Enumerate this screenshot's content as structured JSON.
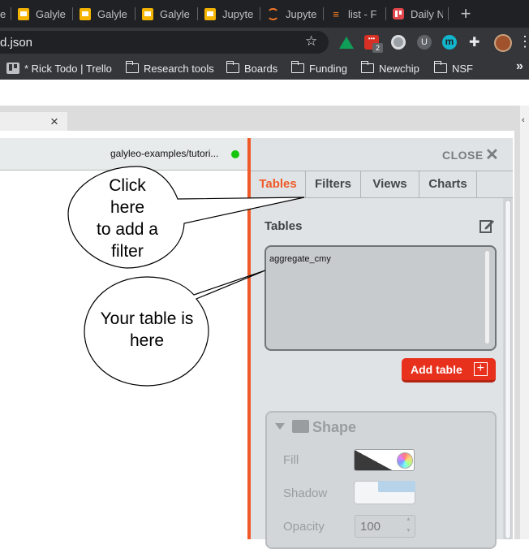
{
  "browser": {
    "tabs": [
      {
        "label": "e",
        "icon": "slides-icon"
      },
      {
        "label": "Galyle",
        "icon": "slides-icon"
      },
      {
        "label": "Galyle",
        "icon": "slides-icon"
      },
      {
        "label": "Galyle",
        "icon": "slides-icon"
      },
      {
        "label": "Jupyte",
        "icon": "slides-icon"
      },
      {
        "label": "Jupyte",
        "icon": "jupyter-icon"
      },
      {
        "label": "list - F",
        "icon": "stackoverflow-icon"
      },
      {
        "label": "Daily N",
        "icon": "trello-icon"
      }
    ],
    "new_tab_glyph": "+",
    "url": "d.json",
    "bookmark_star": "☆",
    "extension_badge": "2",
    "extension_m": "m",
    "bookmarks": [
      {
        "label": "* Rick Todo | Trello",
        "icon": "trello-icon"
      },
      {
        "label": "Research tools",
        "icon": "folder-icon"
      },
      {
        "label": "Boards",
        "icon": "folder-icon"
      },
      {
        "label": "Funding",
        "icon": "folder-icon"
      },
      {
        "label": "Newchip",
        "icon": "folder-icon"
      },
      {
        "label": "NSF",
        "icon": "folder-icon"
      }
    ],
    "bookmarks_overflow": "»"
  },
  "app": {
    "tab_close": "×",
    "file_path": "galyleo-examples/tutori...",
    "status_color": "#16c60c",
    "panel": {
      "close_label": "CLOSE",
      "close_icon": "✕",
      "tabs": [
        "Tables",
        "Filters",
        "Views",
        "Charts"
      ],
      "active_tab": "Tables",
      "section_title": "Tables",
      "table_items": [
        "aggregate_cmy"
      ],
      "add_table_label": "Add table",
      "add_table_icon": "+",
      "shape": {
        "title": "Shape",
        "fill_label": "Fill",
        "shadow_label": "Shadow",
        "opacity_label": "Opacity",
        "opacity_value": "100"
      }
    },
    "accent_color": "#f05a28"
  },
  "callouts": {
    "filter_callout": [
      "Click",
      "here",
      "to add a",
      "filter"
    ],
    "table_callout": [
      "Your table is",
      "here"
    ]
  }
}
